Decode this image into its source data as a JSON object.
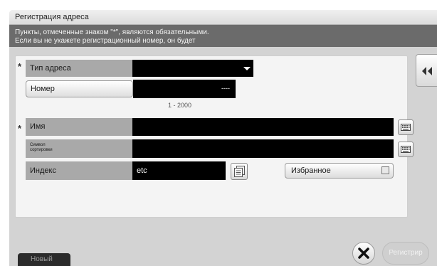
{
  "window": {
    "title": "Регистрация адреса"
  },
  "message": {
    "line1": "Пункты, отмеченные знаком \"*\", являются обязательными.",
    "line2": "Если вы не укажете регистрационный номер, он будет"
  },
  "form": {
    "required_mark": "*",
    "address_type": {
      "label": "Тип адреса",
      "value": ""
    },
    "number": {
      "label": "Номер",
      "value": "----",
      "range": "1 - 2000"
    },
    "name": {
      "label": "Имя",
      "value": ""
    },
    "sort_char": {
      "label_line1": "Символ",
      "label_line2": "сортировки",
      "value": ""
    },
    "index": {
      "label": "Индекс",
      "value": "etc"
    },
    "favorite": {
      "label": "Избранное",
      "checked": false
    }
  },
  "footer": {
    "new_tab": "Новый",
    "register_button": "Регистрир"
  },
  "icons": {
    "side": "double-chevron-left-icon",
    "close": "close-icon",
    "keyboard": "keyboard-icon",
    "index_list": "index-list-icon"
  }
}
